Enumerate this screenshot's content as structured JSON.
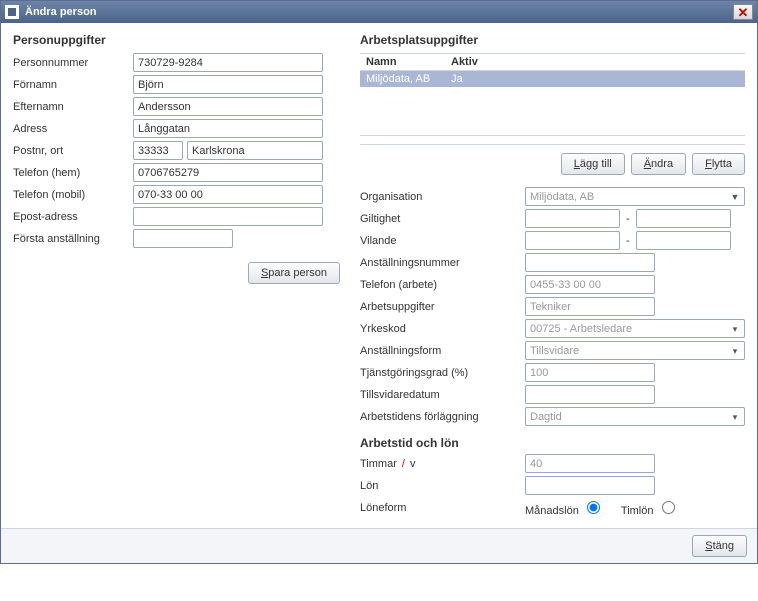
{
  "window": {
    "title": "Ändra person"
  },
  "left": {
    "section": "Personuppgifter",
    "personnummer_label": "Personnummer",
    "personnummer": "730729-9284",
    "fornamn_label": "Förnamn",
    "fornamn": "Björn",
    "efternamn_label": "Efternamn",
    "efternamn": "Andersson",
    "adress_label": "Adress",
    "adress": "Långgatan",
    "postnr_label": "Postnr, ort",
    "postnr": "33333",
    "ort": "Karlskrona",
    "telefon_hem_label": "Telefon (hem)",
    "telefon_hem": "0706765279",
    "telefon_mobil_label": "Telefon (mobil)",
    "telefon_mobil": "070-33 00 00",
    "epost_label": "Epost-adress",
    "epost": "",
    "forsta_anst_label": "Första anställning",
    "forsta_anst": "",
    "save_btn": "para person",
    "save_btn_ul": "S"
  },
  "right": {
    "section": "Arbetsplatsuppgifter",
    "grid": {
      "col_namn": "Namn",
      "col_aktiv": "Aktiv",
      "rows": [
        {
          "namn": "Miljödata, AB",
          "aktiv": "Ja"
        }
      ]
    },
    "btn_add": "ägg till",
    "btn_add_ul": "L",
    "btn_edit": "ndra",
    "btn_edit_ul": "Ä",
    "btn_move": "lytta",
    "btn_move_ul": "F",
    "org_label": "Organisation",
    "org": "Miljödata, AB",
    "giltighet_label": "Giltighet",
    "giltighet_from": "",
    "giltighet_to": "",
    "vilande_label": "Vilande",
    "vilande_from": "",
    "vilande_to": "",
    "anstnr_label": "Anställningsnummer",
    "anstnr": "",
    "tel_arb_label": "Telefon (arbete)",
    "tel_arb": "0455-33 00 00",
    "arbuppg_label": "Arbetsuppgifter",
    "arbuppg": "Tekniker",
    "yrkeskod_label": "Yrkeskod",
    "yrkeskod": "00725 - Arbetsledare",
    "anstform_label": "Anställningsform",
    "anstform": "Tillsvidare",
    "tjgrad_label": "Tjänstgöringsgrad (%)",
    "tjgrad": "100",
    "tillsvidare_label": "Tillsvidaredatum",
    "tillsvidare": "",
    "arbforl_label": "Arbetstidens förläggning",
    "arbforl": "Dagtid",
    "sub_section": "Arbetstid och lön",
    "timmar_label_a": "Timmar ",
    "timmar_label_b": " v",
    "timmar": "40",
    "lon_label": "Lön",
    "lon": "",
    "loneform_label": "Löneform",
    "manadslon": "Månadslön",
    "timlon": "Timlön"
  },
  "footer": {
    "close_btn": "täng",
    "close_btn_ul": "S"
  }
}
